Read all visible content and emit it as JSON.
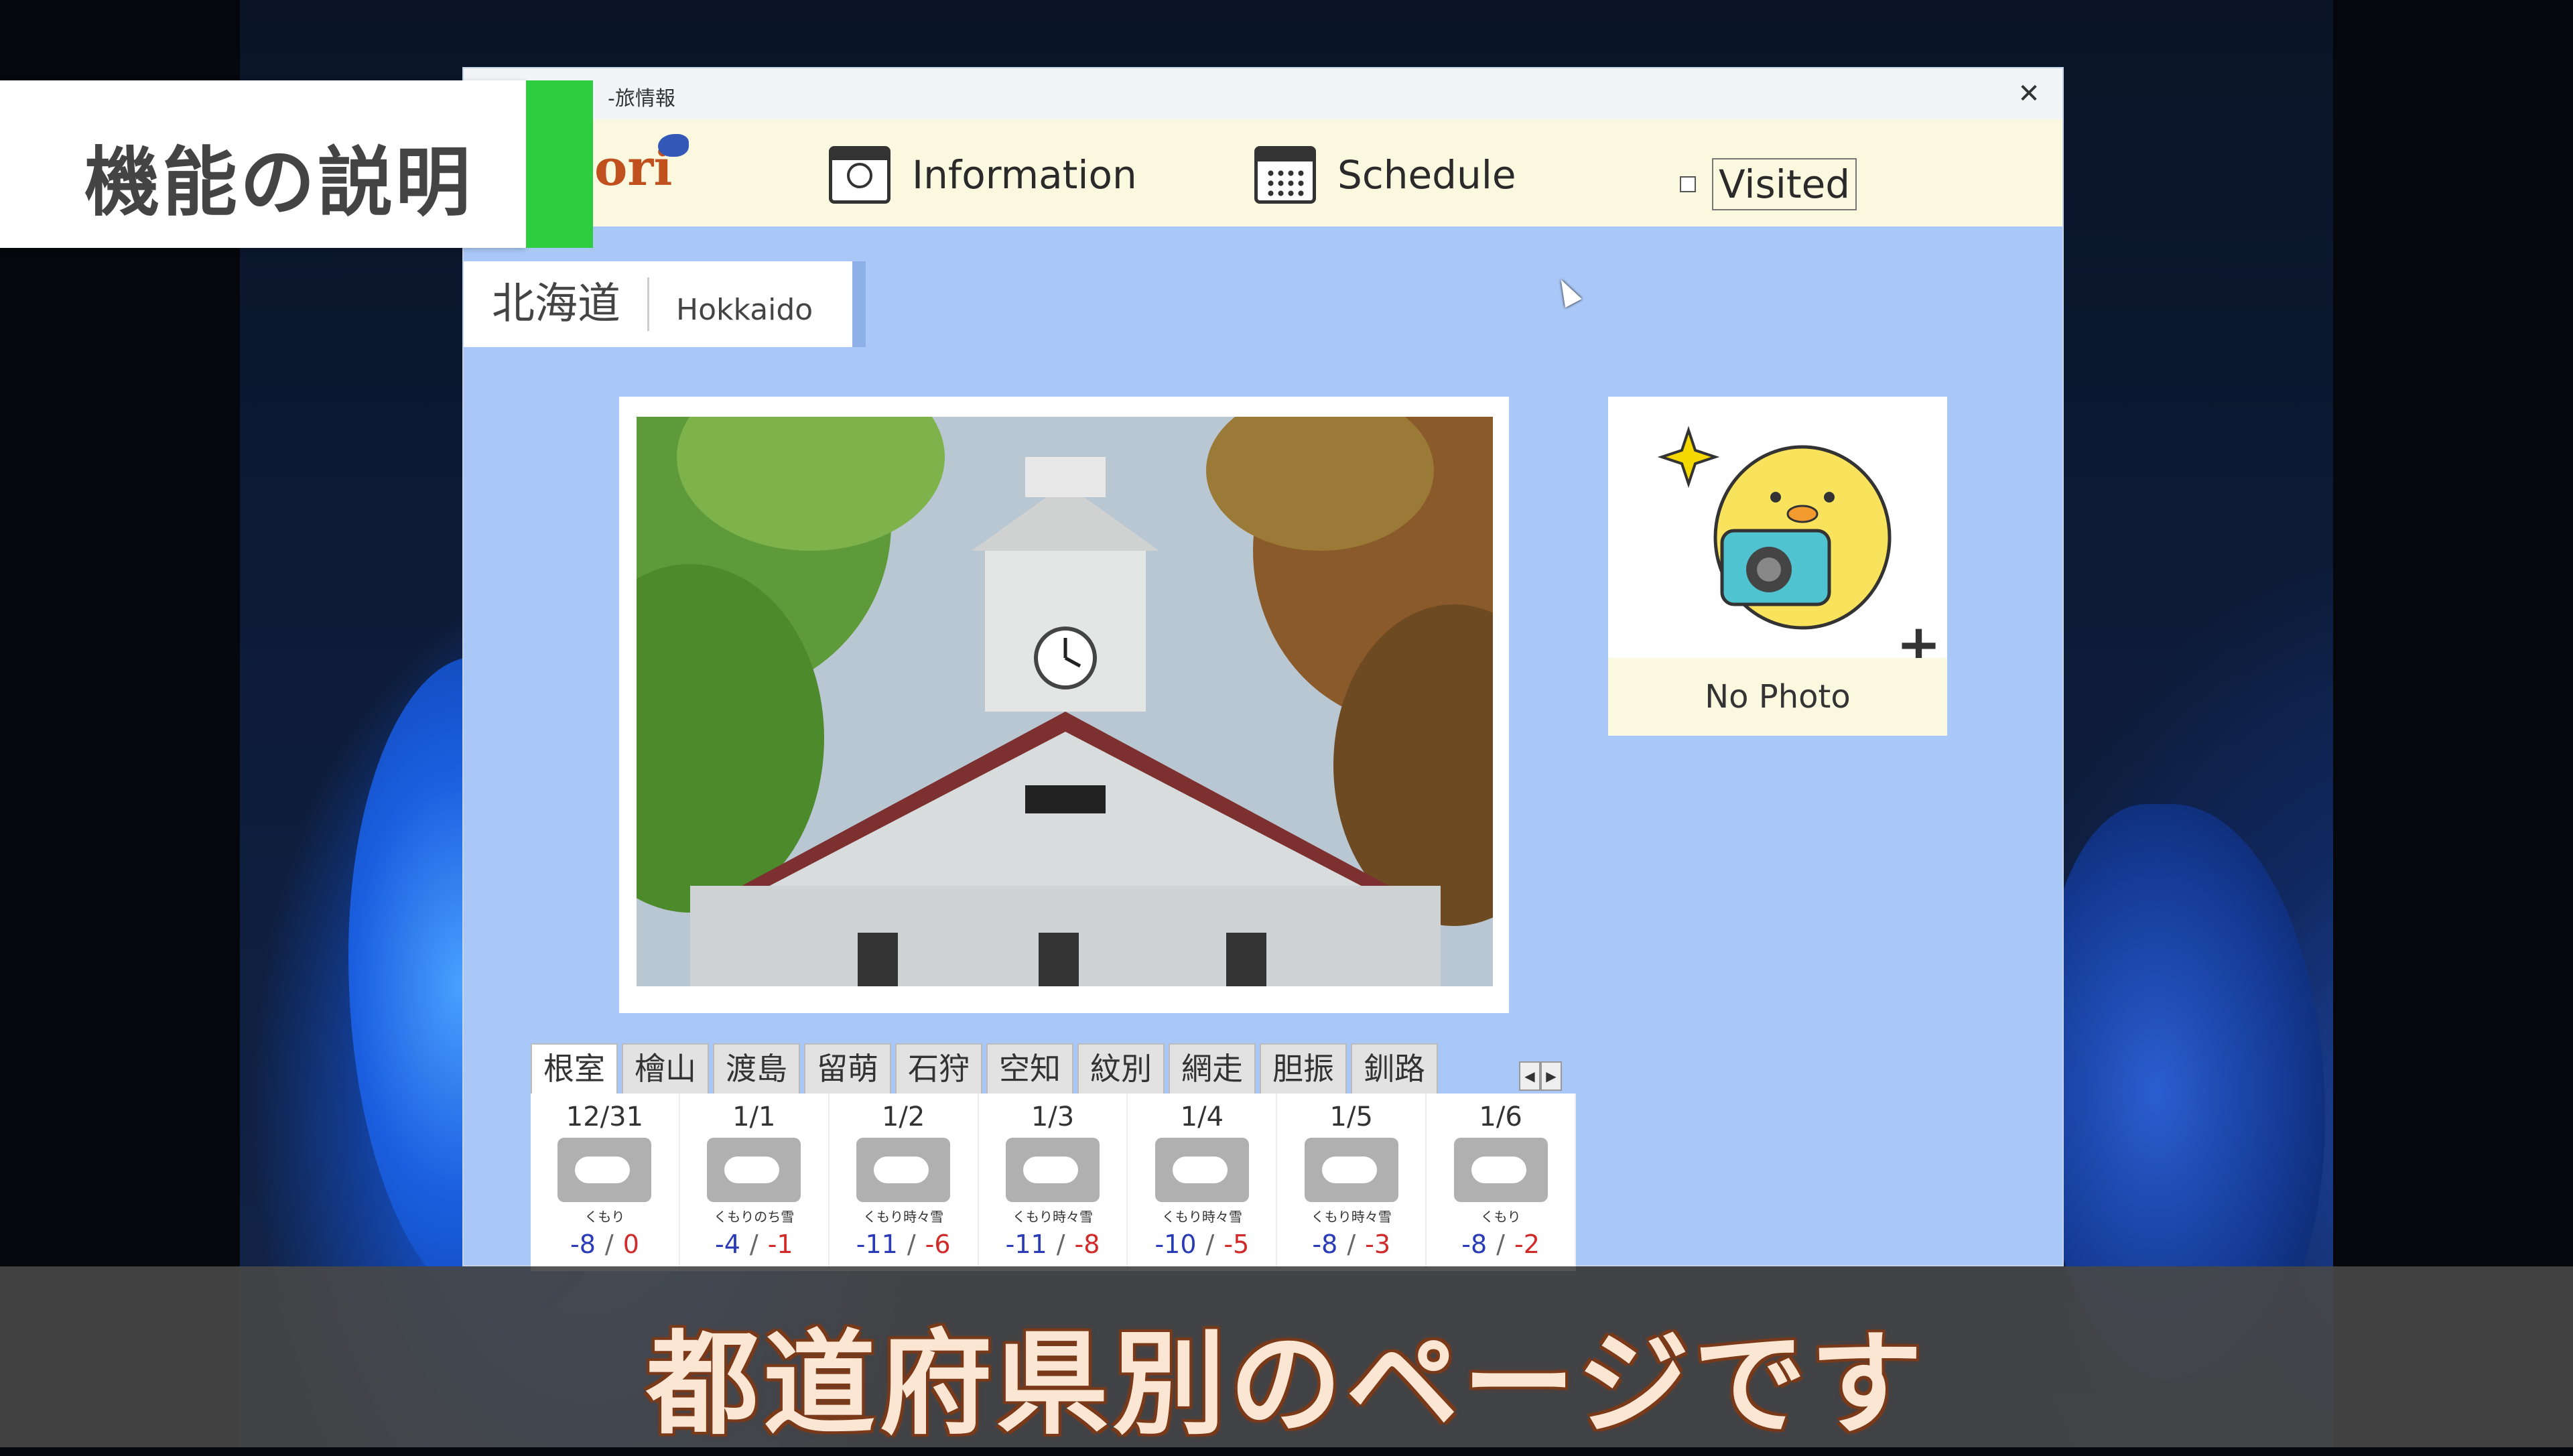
{
  "overlay": {
    "function_label": "機能の説明",
    "caption": "都道府県別のページです"
  },
  "window": {
    "title": "-旅情報",
    "close_glyph": "✕"
  },
  "toolbar": {
    "logo_text": "ori",
    "information_label": "Information",
    "schedule_label": "Schedule",
    "visited_label": "Visited",
    "visited_checked": false
  },
  "prefecture": {
    "name_jp": "北海道",
    "name_en": "Hokkaido"
  },
  "no_photo": {
    "label": "No Photo",
    "plus": "+"
  },
  "tabs": [
    "根室",
    "檜山",
    "渡島",
    "留萌",
    "石狩",
    "空知",
    "紋別",
    "網走",
    "胆振",
    "釧路"
  ],
  "tab_arrows": {
    "left": "◀",
    "right": "▶"
  },
  "forecast": [
    {
      "date": "12/31",
      "condition": "くもり",
      "low": "-8",
      "high": "0"
    },
    {
      "date": "1/1",
      "condition": "くもりのち雪",
      "low": "-4",
      "high": "-1"
    },
    {
      "date": "1/2",
      "condition": "くもり時々雪",
      "low": "-11",
      "high": "-6"
    },
    {
      "date": "1/3",
      "condition": "くもり時々雪",
      "low": "-11",
      "high": "-8"
    },
    {
      "date": "1/4",
      "condition": "くもり時々雪",
      "low": "-10",
      "high": "-5"
    },
    {
      "date": "1/5",
      "condition": "くもり時々雪",
      "low": "-8",
      "high": "-3"
    },
    {
      "date": "1/6",
      "condition": "くもり",
      "low": "-8",
      "high": "-2"
    }
  ],
  "temp_separator": "/",
  "colors": {
    "window_bg": "#aac8f7",
    "toolbar_bg": "#fbf8e0",
    "temp_low": "#2a3bb8",
    "temp_high": "#d02a2a",
    "function_bar": "#2ecc40"
  }
}
